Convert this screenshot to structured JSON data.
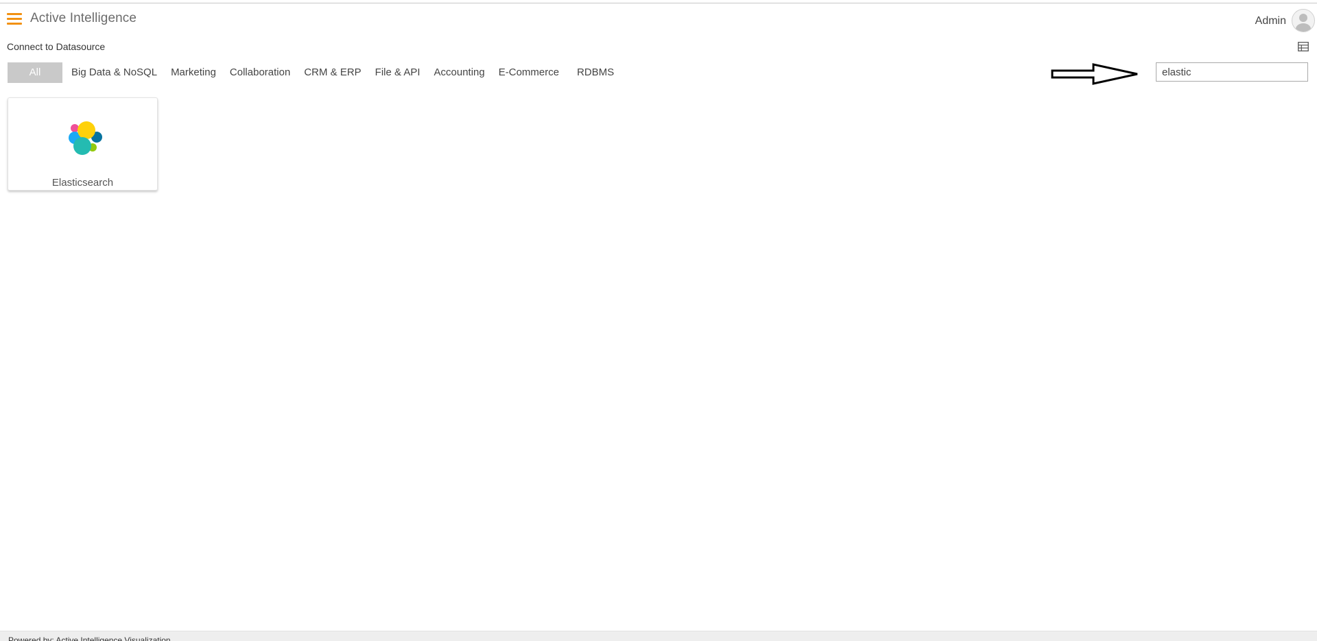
{
  "header": {
    "title": "Active Intelligence",
    "user_name": "Admin",
    "accent_color": "#f29111",
    "menu_icon": "hamburger-menu-icon",
    "avatar_icon": "user-avatar-icon"
  },
  "subheader": {
    "title": "Connect to Datasource",
    "view_icon": "table-view-icon"
  },
  "tabs": [
    {
      "label": "All",
      "active": true
    },
    {
      "label": "Big Data & NoSQL",
      "active": false
    },
    {
      "label": "Marketing",
      "active": false
    },
    {
      "label": "Collaboration",
      "active": false
    },
    {
      "label": "CRM & ERP",
      "active": false
    },
    {
      "label": "File & API",
      "active": false
    },
    {
      "label": "Accounting",
      "active": false
    },
    {
      "label": "E-Commerce",
      "active": false
    },
    {
      "label": "RDBMS",
      "active": false
    }
  ],
  "search": {
    "value": "elastic",
    "placeholder": ""
  },
  "annotation": {
    "icon": "right-arrow-icon"
  },
  "datasources": [
    {
      "name": "Elasticsearch",
      "icon": "elasticsearch-logo-icon"
    }
  ],
  "footer": {
    "text": "Powered by: Active Intelligence Visualization"
  }
}
